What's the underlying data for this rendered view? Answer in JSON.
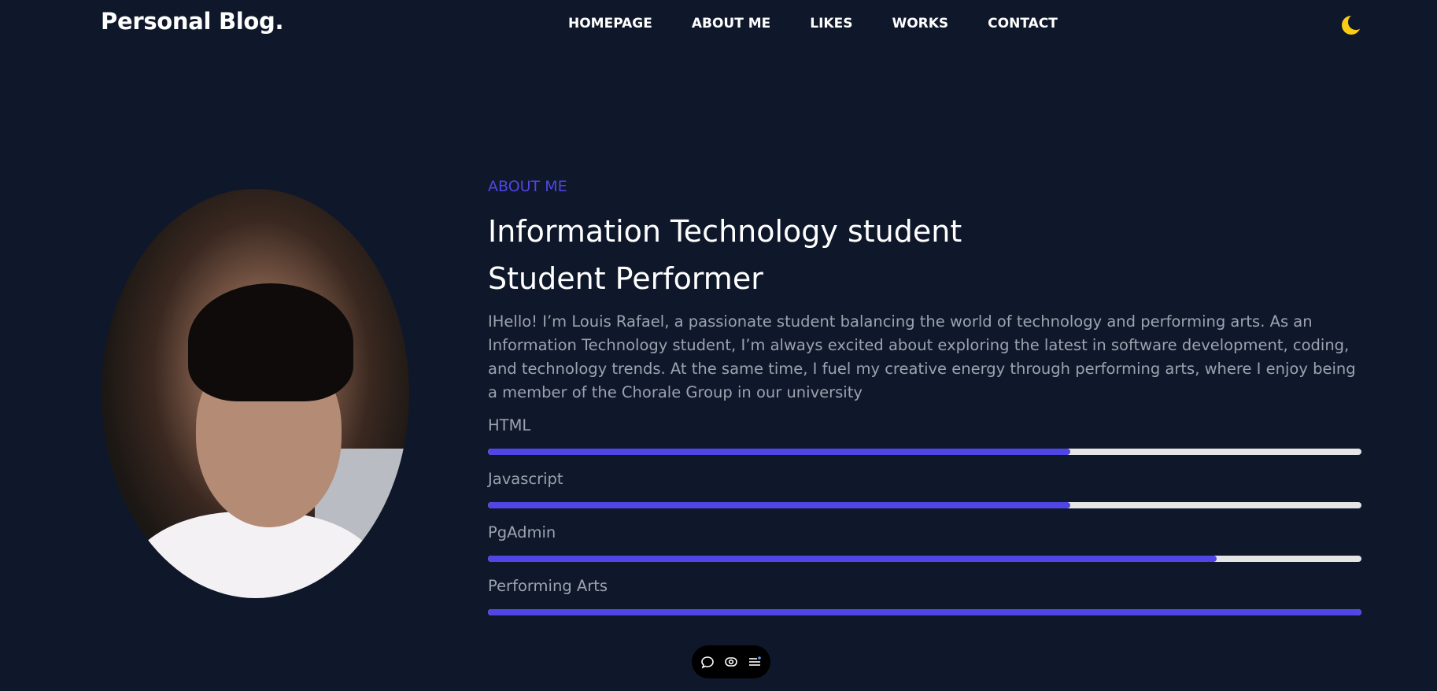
{
  "header": {
    "brand": "Personal Blog.",
    "nav": [
      "HOMEPAGE",
      "ABOUT ME",
      "LIKES",
      "WORKS",
      "CONTACT"
    ],
    "theme_toggle_icon": "moon-icon"
  },
  "about": {
    "eyebrow": "ABOUT ME",
    "headline_1": "Information Technology student",
    "headline_2": "Student Performer",
    "intro": "IHello! I’m Louis Rafael, a passionate student balancing the world of technology and performing arts. As an Information Technology student, I’m always excited about exploring the latest in software development, coding, and technology trends. At the same time, I fuel my creative energy through performing arts, where I enjoy being a member of the Chorale Group in our university",
    "skills": [
      {
        "name": "HTML",
        "level": 0.667
      },
      {
        "name": "Javascript",
        "level": 0.667
      },
      {
        "name": "PgAdmin",
        "level": 0.834
      },
      {
        "name": "Performing Arts",
        "level": 1.0
      }
    ]
  },
  "toolbar": {
    "icons": [
      "comment-icon",
      "eye-icon",
      "list-icon"
    ]
  },
  "colors": {
    "background": "#0f172a",
    "accent": "#4f46e5",
    "track": "#e5e5e5",
    "muted_text": "#9ca3af",
    "moon": "#facc15"
  }
}
